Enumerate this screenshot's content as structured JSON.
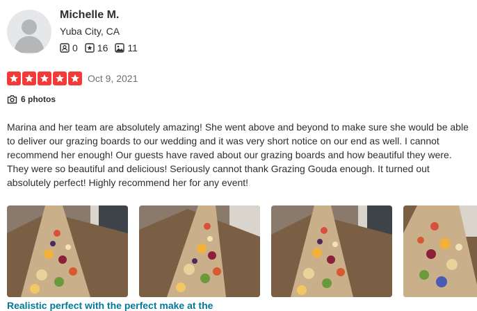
{
  "reviewer": {
    "name": "Michelle M.",
    "location": "Yuba City, CA",
    "stats": {
      "friends": "0",
      "reviews": "16",
      "photos": "11"
    }
  },
  "review": {
    "rating": 5,
    "rating_max": 5,
    "date": "Oct 9, 2021",
    "photos_label": "6 photos",
    "text": "Marina and her team are absolutely amazing! She went above and beyond to make sure she would be able to deliver our grazing boards to our wedding and it was very short notice on our end as well. I cannot recommend her enough! Our guests have raved about our grazing boards and how beautiful they were. They were so beautiful and delicious! Seriously cannot thank Grazing Gouda enough. It turned out absolutely perfect! Highly recommend her for any event!"
  },
  "bottom_link": "Realistic perfect with the perfect make at the",
  "colors": {
    "star_red": "#f43939",
    "link_teal": "#027a97",
    "muted": "#6e7072"
  },
  "icons": [
    "friends-icon",
    "review-star-icon",
    "photo-icon",
    "camera-icon",
    "star-icon"
  ]
}
